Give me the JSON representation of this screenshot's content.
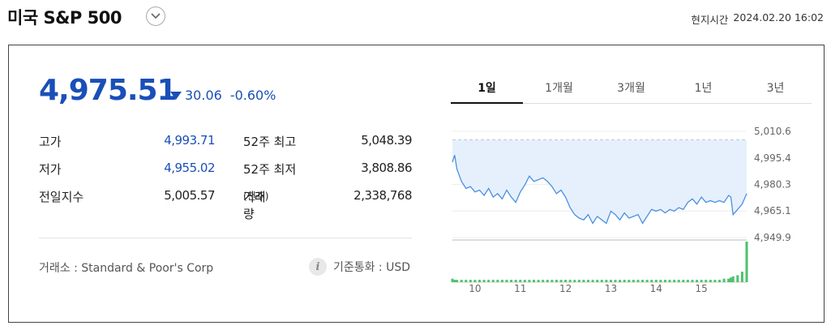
{
  "header": {
    "title": "미국 S&P 500",
    "time_label": "현지시간",
    "datetime": "2024.02.20 16:02"
  },
  "quote": {
    "price": "4,975.51",
    "change": "30.06",
    "change_pct": "-0.60%",
    "direction": "down",
    "color": "#1a4fb8"
  },
  "stats": [
    {
      "label": "고가",
      "value": "4,993.71",
      "label2": "52주 최고",
      "value2": "5,048.39"
    },
    {
      "label": "저가",
      "value": "4,955.02",
      "label2": "52주 최저",
      "value2": "3,808.86"
    },
    {
      "label": "전일지수",
      "value": "5,005.57",
      "label2": "거래량",
      "label2_unit": "(천주)",
      "value2": "2,338,768"
    }
  ],
  "footer": {
    "exchange": "거래소 : Standard & Poor's Corp",
    "currency": "기준통화 : USD",
    "info_icon": "info-icon"
  },
  "tabs": [
    {
      "label": "1일",
      "active": true
    },
    {
      "label": "1개월",
      "active": false
    },
    {
      "label": "3개월",
      "active": false
    },
    {
      "label": "1년",
      "active": false
    },
    {
      "label": "3년",
      "active": false
    }
  ],
  "chart_data": {
    "type": "area",
    "y_ticks": [
      "5,010.6",
      "4,995.4",
      "4,980.3",
      "4,965.1",
      "4,949.9"
    ],
    "y_tick_values": [
      5010.6,
      4995.4,
      4980.3,
      4965.1,
      4949.9
    ],
    "ylim": [
      4949.9,
      5010.6
    ],
    "previous_close": 5005.57,
    "x_ticks": [
      "10",
      "11",
      "12",
      "13",
      "14",
      "15"
    ],
    "x_tick_positions": [
      10,
      11,
      12,
      13,
      14,
      15
    ],
    "xlim": [
      9.5,
      16.0
    ],
    "line_color": "#4a90e2",
    "fill_color": "#e6f0fc",
    "volume_color": "#4cc26b",
    "series": [
      {
        "x": [
          9.5,
          9.55,
          9.6,
          9.7,
          9.8,
          9.9,
          10.0,
          10.1,
          10.2,
          10.3,
          10.4,
          10.5,
          10.6,
          10.7,
          10.8,
          10.9,
          11.0,
          11.1,
          11.2,
          11.3,
          11.4,
          11.5,
          11.6,
          11.7,
          11.8,
          11.9,
          12.0,
          12.1,
          12.2,
          12.3,
          12.4,
          12.5,
          12.6,
          12.7,
          12.8,
          12.9,
          13.0,
          13.1,
          13.2,
          13.3,
          13.4,
          13.5,
          13.6,
          13.7,
          13.8,
          13.9,
          14.0,
          14.1,
          14.2,
          14.3,
          14.4,
          14.5,
          14.6,
          14.7,
          14.8,
          14.9,
          15.0,
          15.1,
          15.2,
          15.3,
          15.4,
          15.5,
          15.6,
          15.65,
          15.7,
          15.8,
          15.9,
          16.0
        ],
        "y": [
          4993,
          4997,
          4989,
          4982,
          4978,
          4979,
          4976,
          4977,
          4974,
          4978,
          4973,
          4975,
          4972,
          4977,
          4973,
          4970,
          4976,
          4980,
          4985,
          4982,
          4983,
          4984,
          4982,
          4979,
          4975,
          4977,
          4973,
          4967,
          4963,
          4961,
          4960,
          4963,
          4958,
          4962,
          4960,
          4958,
          4965,
          4963,
          4960,
          4964,
          4961,
          4962,
          4963,
          4958,
          4962,
          4966,
          4965,
          4966,
          4964,
          4966,
          4965,
          4967,
          4966,
          4970,
          4972,
          4969,
          4973,
          4970,
          4971,
          4970,
          4971,
          4970,
          4974,
          4973,
          4963,
          4966,
          4969,
          4975
        ]
      }
    ],
    "volume": [
      3,
      2,
      2,
      2,
      2,
      2,
      2,
      2,
      2,
      2,
      2,
      2,
      2,
      2,
      2,
      2,
      2,
      2,
      2,
      2,
      2,
      2,
      2,
      2,
      2,
      2,
      2,
      2,
      2,
      2,
      2,
      2,
      2,
      2,
      2,
      2,
      2,
      2,
      2,
      2,
      2,
      2,
      2,
      2,
      2,
      2,
      2,
      2,
      2,
      2,
      2,
      2,
      2,
      2,
      2,
      2,
      2,
      2,
      2,
      2,
      2,
      3,
      3,
      4,
      5,
      6,
      9,
      35
    ]
  }
}
